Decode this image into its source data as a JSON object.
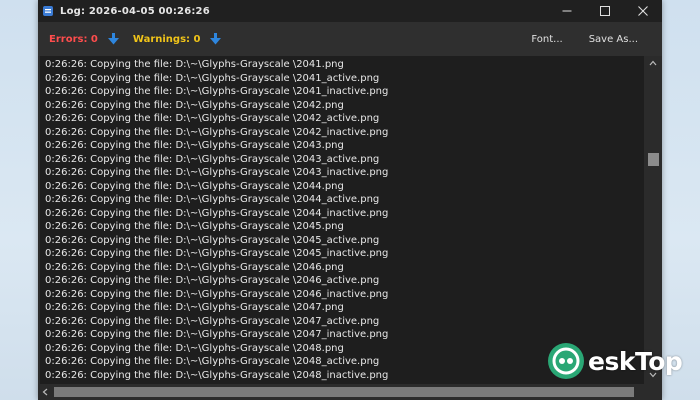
{
  "window": {
    "title": "Log: 2026-04-05 00:26:26"
  },
  "toolbar": {
    "errors_label": "Errors: 0",
    "warnings_label": "Warnings: 0",
    "font_label": "Font...",
    "save_label": "Save As..."
  },
  "colors": {
    "errors": "#ff4d4d",
    "warnings": "#f0c419",
    "arrow": "#2e86de",
    "watermark": "#2aa775"
  },
  "log_lines": [
    "0:26:26: Copying the file: D:\\~\\Glyphs-Grayscale \\2041.png",
    "0:26:26: Copying the file: D:\\~\\Glyphs-Grayscale \\2041_active.png",
    "0:26:26: Copying the file: D:\\~\\Glyphs-Grayscale \\2041_inactive.png",
    "0:26:26: Copying the file: D:\\~\\Glyphs-Grayscale \\2042.png",
    "0:26:26: Copying the file: D:\\~\\Glyphs-Grayscale \\2042_active.png",
    "0:26:26: Copying the file: D:\\~\\Glyphs-Grayscale \\2042_inactive.png",
    "0:26:26: Copying the file: D:\\~\\Glyphs-Grayscale \\2043.png",
    "0:26:26: Copying the file: D:\\~\\Glyphs-Grayscale \\2043_active.png",
    "0:26:26: Copying the file: D:\\~\\Glyphs-Grayscale \\2043_inactive.png",
    "0:26:26: Copying the file: D:\\~\\Glyphs-Grayscale \\2044.png",
    "0:26:26: Copying the file: D:\\~\\Glyphs-Grayscale \\2044_active.png",
    "0:26:26: Copying the file: D:\\~\\Glyphs-Grayscale \\2044_inactive.png",
    "0:26:26: Copying the file: D:\\~\\Glyphs-Grayscale \\2045.png",
    "0:26:26: Copying the file: D:\\~\\Glyphs-Grayscale \\2045_active.png",
    "0:26:26: Copying the file: D:\\~\\Glyphs-Grayscale \\2045_inactive.png",
    "0:26:26: Copying the file: D:\\~\\Glyphs-Grayscale \\2046.png",
    "0:26:26: Copying the file: D:\\~\\Glyphs-Grayscale \\2046_active.png",
    "0:26:26: Copying the file: D:\\~\\Glyphs-Grayscale \\2046_inactive.png",
    "0:26:26: Copying the file: D:\\~\\Glyphs-Grayscale \\2047.png",
    "0:26:26: Copying the file: D:\\~\\Glyphs-Grayscale \\2047_active.png",
    "0:26:26: Copying the file: D:\\~\\Glyphs-Grayscale \\2047_inactive.png",
    "0:26:26: Copying the file: D:\\~\\Glyphs-Grayscale \\2048.png",
    "0:26:26: Copying the file: D:\\~\\Glyphs-Grayscale \\2048_active.png",
    "0:26:26: Copying the file: D:\\~\\Glyphs-Grayscale \\2048_inactive.png"
  ],
  "watermark": {
    "text": "eskTop"
  }
}
